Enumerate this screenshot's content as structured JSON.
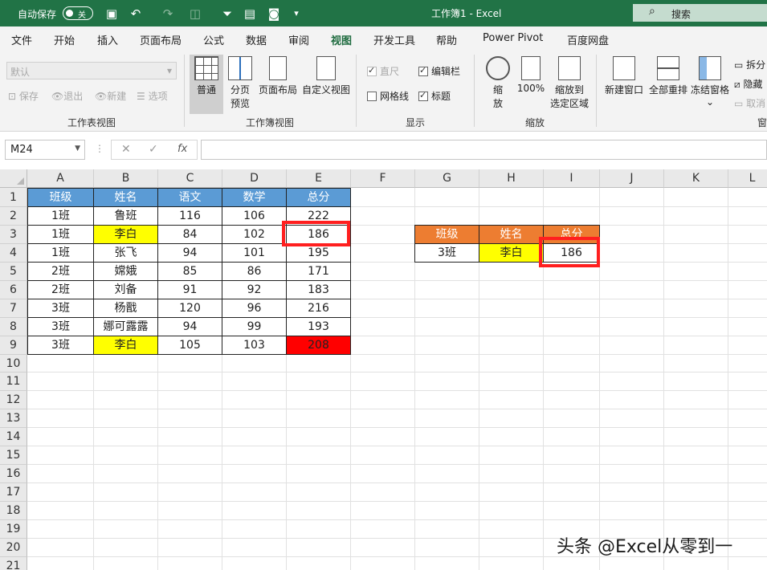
{
  "titlebar": {
    "autosave_label": "自动保存",
    "autosave_state": "关",
    "doc_title": "工作簿1  -  Excel",
    "search_placeholder": "搜索"
  },
  "menu": {
    "tabs": [
      "文件",
      "开始",
      "插入",
      "页面布局",
      "公式",
      "数据",
      "审阅",
      "视图",
      "开发工具",
      "帮助",
      "Power Pivot",
      "百度网盘"
    ],
    "active": "视图"
  },
  "ribbon": {
    "sheet_view": {
      "dropdown_value": "默认",
      "keep": "保存",
      "exit": "退出",
      "new": "新建",
      "options": "选项",
      "label": "工作表视图"
    },
    "workbook_view": {
      "normal": "普通",
      "page_break_1": "分页",
      "page_break_2": "预览",
      "page_layout": "页面布局",
      "custom_views": "自定义视图",
      "label": "工作簿视图"
    },
    "show": {
      "ruler": "直尺",
      "formula_bar": "编辑栏",
      "gridlines": "网格线",
      "headings": "标题",
      "label": "显示"
    },
    "zoom": {
      "zoom_1": "缩",
      "zoom_2": "放",
      "hundred": "100%",
      "to_sel_1": "缩放到",
      "to_sel_2": "选定区域",
      "label": "缩放"
    },
    "window": {
      "new_window": "新建窗口",
      "arrange_all": "全部重排",
      "freeze": "冻结窗格",
      "split": "拆分",
      "hide": "隐藏",
      "unhide": "取消",
      "label": "窗"
    }
  },
  "formula_bar": {
    "name_box": "M24",
    "fx": "fx",
    "cancel": "✕",
    "enter": "✓",
    "formula": ""
  },
  "columns": [
    "A",
    "B",
    "C",
    "D",
    "E",
    "F",
    "G",
    "H",
    "I",
    "J",
    "K",
    "L"
  ],
  "rows": [
    "1",
    "2",
    "3",
    "4",
    "5",
    "6",
    "7",
    "8",
    "9",
    "10",
    "11",
    "12",
    "13",
    "14",
    "15",
    "16",
    "17",
    "18",
    "19",
    "20",
    "21"
  ],
  "main_table": {
    "headers": [
      "班级",
      "姓名",
      "语文",
      "数学",
      "总分"
    ],
    "rows": [
      [
        "1班",
        "鲁班",
        "116",
        "106",
        "222"
      ],
      [
        "1班",
        "李白",
        "84",
        "102",
        "186"
      ],
      [
        "1班",
        "张飞",
        "94",
        "101",
        "195"
      ],
      [
        "2班",
        "嫦娥",
        "85",
        "86",
        "171"
      ],
      [
        "2班",
        "刘备",
        "91",
        "92",
        "183"
      ],
      [
        "3班",
        "杨戬",
        "120",
        "96",
        "216"
      ],
      [
        "3班",
        "娜可露露",
        "94",
        "99",
        "193"
      ],
      [
        "3班",
        "李白",
        "105",
        "103",
        "208"
      ]
    ]
  },
  "lookup_table": {
    "headers": [
      "班级",
      "姓名",
      "总分"
    ],
    "row": [
      "3班",
      "李白",
      "186"
    ]
  },
  "watermark": "头条 @Excel从零到一"
}
